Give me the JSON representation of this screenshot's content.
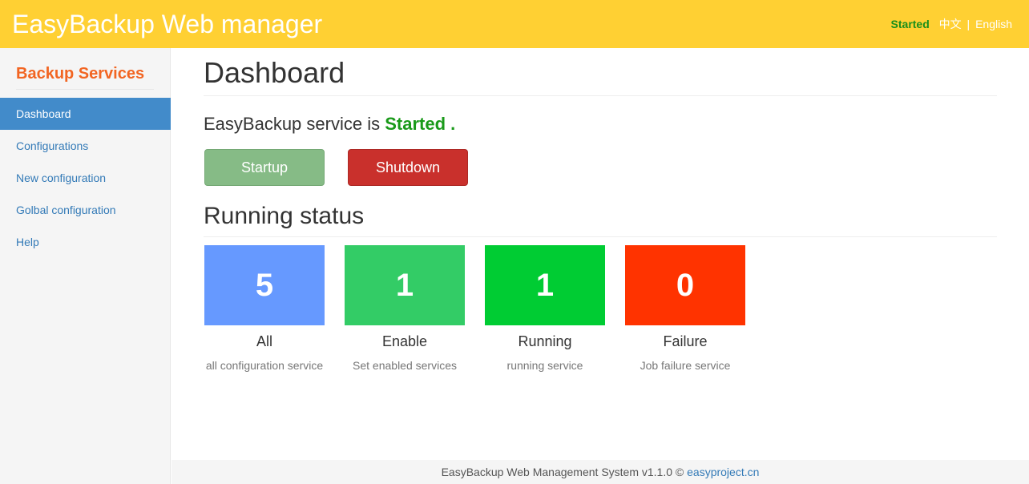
{
  "header": {
    "title": "EasyBackup Web manager",
    "status": "Started",
    "lang_zh": "中文",
    "lang_separator": "|",
    "lang_en": "English"
  },
  "sidebar": {
    "title": "Backup Services",
    "items": [
      {
        "label": "Dashboard",
        "active": true
      },
      {
        "label": "Configurations",
        "active": false
      },
      {
        "label": "New configuration",
        "active": false
      },
      {
        "label": "Golbal configuration",
        "active": false
      },
      {
        "label": "Help",
        "active": false
      }
    ]
  },
  "main": {
    "title": "Dashboard",
    "service_prefix": "EasyBackup service is",
    "service_state": "Started .",
    "buttons": {
      "startup": "Startup",
      "shutdown": "Shutdown"
    },
    "running_status_title": "Running status",
    "stats": [
      {
        "value": "5",
        "label": "All",
        "desc": "all configuration service",
        "color": "#6699ff"
      },
      {
        "value": "1",
        "label": "Enable",
        "desc": "Set enabled services",
        "color": "#33cc66"
      },
      {
        "value": "1",
        "label": "Running",
        "desc": "running service",
        "color": "#00cc33"
      },
      {
        "value": "0",
        "label": "Failure",
        "desc": "Job failure service",
        "color": "#ff3300"
      }
    ]
  },
  "footer": {
    "text": "EasyBackup Web Management System v1.1.0 ©",
    "link": "easyproject.cn"
  },
  "colors": {
    "header_bg": "#ffd033",
    "sidebar_title": "#f26522",
    "nav_active": "#428bca",
    "started_green": "#1a9a1a"
  }
}
